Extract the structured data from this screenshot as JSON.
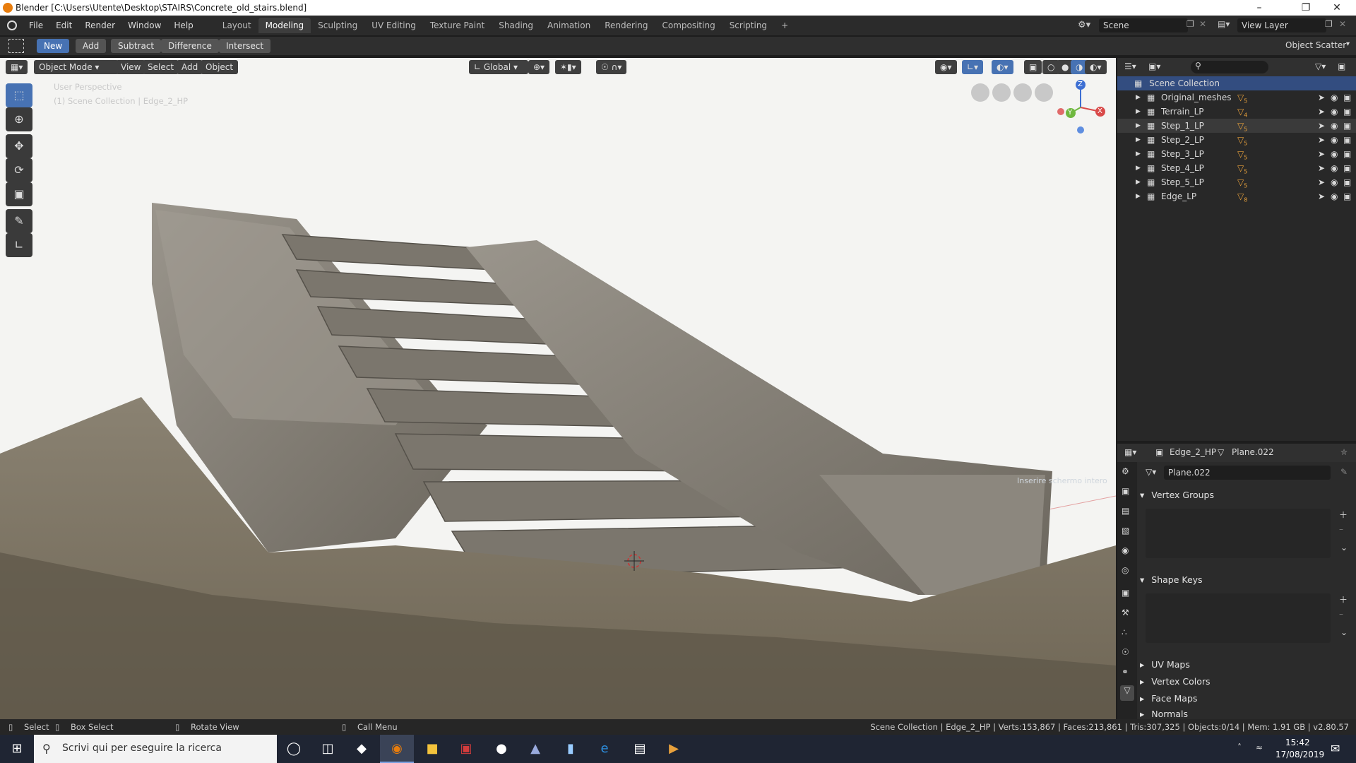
{
  "window": {
    "title": "Blender [C:\\Users\\Utente\\Desktop\\STAIRS\\Concrete_old_stairs.blend]"
  },
  "menubar": {
    "menus": [
      "File",
      "Edit",
      "Render",
      "Window",
      "Help"
    ],
    "workspaces": [
      "Layout",
      "Modeling",
      "Sculpting",
      "UV Editing",
      "Texture Paint",
      "Shading",
      "Animation",
      "Rendering",
      "Compositing",
      "Scripting"
    ],
    "add_tab": "+",
    "scene": "Scene",
    "view_layer": "View Layer"
  },
  "toolsettings": {
    "buttons": [
      "New",
      "Add",
      "Subtract",
      "Difference",
      "Intersect"
    ],
    "active": "New",
    "addon": "Object Scatter"
  },
  "viewport": {
    "mode": "Object Mode",
    "menus": [
      "View",
      "Select",
      "Add",
      "Object"
    ],
    "orientation": "Global",
    "overlay_text_1": "User Perspective",
    "overlay_text_2": "(1) Scene Collection | Edge_2_HP",
    "gizmo_x": "X",
    "gizmo_y": "Y",
    "gizmo_z": "Z",
    "faint_label": "Inserire schermo intero"
  },
  "outliner": {
    "root": "Scene Collection",
    "items": [
      {
        "name": "Original_meshes",
        "badge": "5"
      },
      {
        "name": "Terrain_LP",
        "badge": "4"
      },
      {
        "name": "Step_1_LP",
        "badge": "5"
      },
      {
        "name": "Step_2_LP",
        "badge": "5"
      },
      {
        "name": "Step_3_LP",
        "badge": "5"
      },
      {
        "name": "Step_4_LP",
        "badge": "5"
      },
      {
        "name": "Step_5_LP",
        "badge": "5"
      },
      {
        "name": "Edge_LP",
        "badge": "8"
      }
    ],
    "selected_index": 2
  },
  "properties": {
    "object_name": "Edge_2_HP",
    "mesh_name": "Plane.022",
    "datablock_name": "Plane.022",
    "panels": [
      "Vertex Groups",
      "Shape Keys",
      "UV Maps",
      "Vertex Colors",
      "Face Maps",
      "Normals"
    ]
  },
  "statusbar": {
    "select": "Select",
    "box_select": "Box Select",
    "rotate_view": "Rotate View",
    "call_menu": "Call Menu",
    "stats": "Scene Collection | Edge_2_HP | Verts:153,867 | Faces:213,861 | Tris:307,325 | Objects:0/14 | Mem: 1.91 GB | v2.80.57"
  },
  "taskbar": {
    "search_placeholder": "Scrivi qui per eseguire la ricerca",
    "time": "15:42",
    "date": "17/08/2019"
  }
}
